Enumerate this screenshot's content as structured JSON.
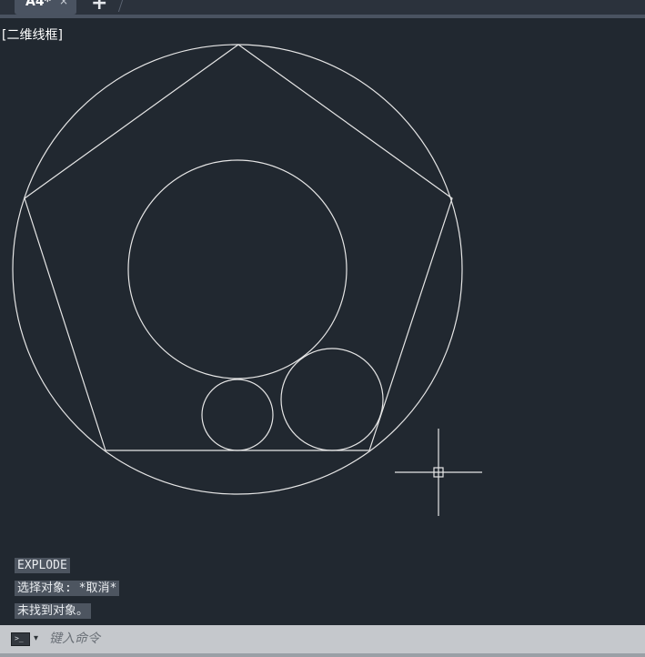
{
  "tabs": [
    {
      "label": "A4*",
      "close": "×",
      "active": true
    }
  ],
  "new_tab_label": "+",
  "view_label": "[二维线框]",
  "command_history": [
    "EXPLODE",
    "选择对象: *取消*",
    "未找到对象。"
  ],
  "command_line": {
    "placeholder": "键入命令",
    "value": "",
    "icon": "command-line-icon",
    "icon_glyph": ">_",
    "dropdown_glyph": "▾"
  },
  "colors": {
    "canvas": "#212830",
    "linework": "#e6e6e6",
    "tab_active": "#4a5361",
    "command_bar": "#c5c8cc"
  }
}
